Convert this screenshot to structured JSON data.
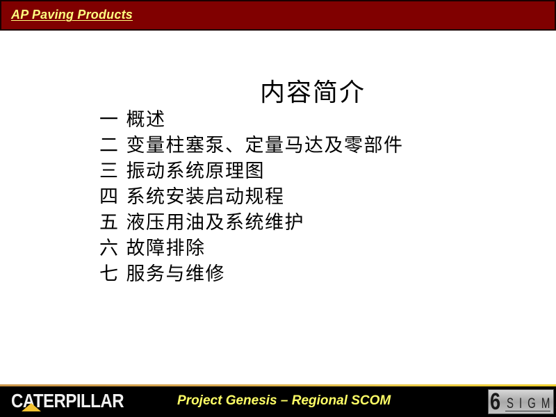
{
  "header": {
    "title": "AP Paving Products",
    "background_color": "#800000",
    "title_color": "#ffff80"
  },
  "content": {
    "title": "内容简介",
    "items": [
      {
        "number": "一",
        "label": "概述"
      },
      {
        "number": "二",
        "label": "变量柱塞泵、定量马达及零部件"
      },
      {
        "number": "三",
        "label": "振动系统原理图"
      },
      {
        "number": "四",
        "label": "系统安装启动规程"
      },
      {
        "number": "五",
        "label": "液压用油及系统维护"
      },
      {
        "number": "六",
        "label": "故障排除"
      },
      {
        "number": "七",
        "label": "服务与维修"
      }
    ]
  },
  "footer": {
    "left_logo_text": "CATERPILLAR",
    "center_text": "Project Genesis – Regional  SCOM",
    "right_logo_number": "6",
    "right_logo_text": "SIGMA",
    "background_color": "#000000",
    "text_color": "#ffff66",
    "accent_line_color": "#d9a94f"
  }
}
